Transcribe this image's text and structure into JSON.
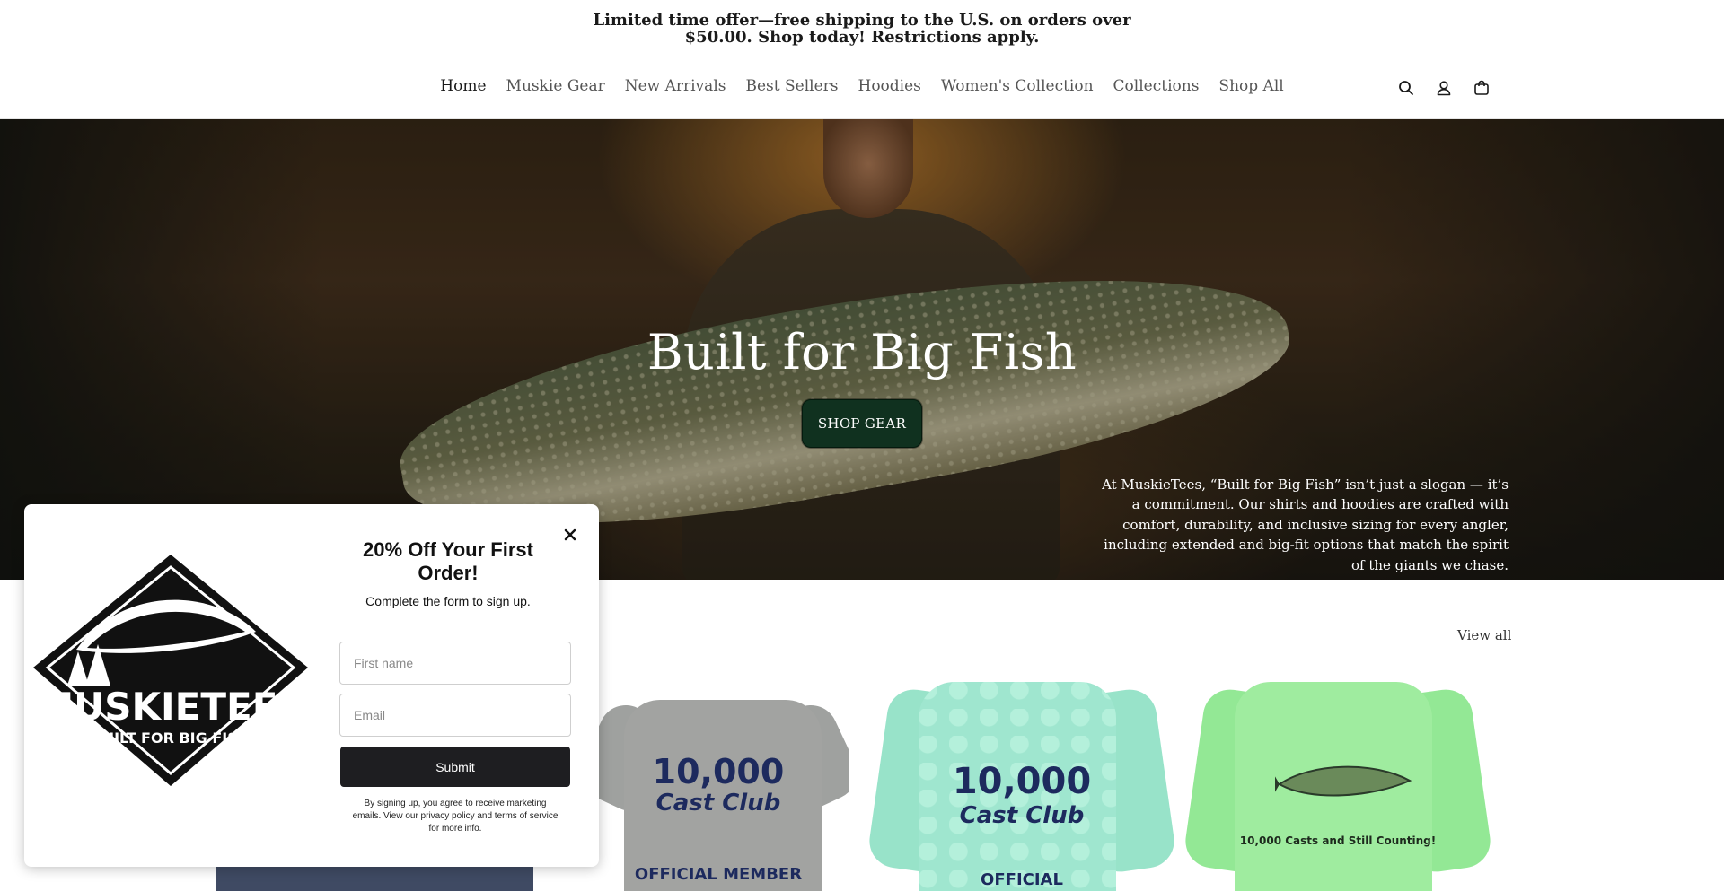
{
  "announcement": {
    "text": "Limited time offer—free shipping to the U.S. on orders over $50.00. Shop today! Restrictions apply."
  },
  "nav": {
    "items": [
      {
        "label": "Home"
      },
      {
        "label": "Muskie Gear"
      },
      {
        "label": "New Arrivals"
      },
      {
        "label": "Best Sellers"
      },
      {
        "label": "Hoodies"
      },
      {
        "label": "Women's Collection"
      },
      {
        "label": "Collections"
      },
      {
        "label": "Shop All"
      }
    ],
    "active_index": 0,
    "icons": [
      "search-icon",
      "account-icon",
      "cart-icon"
    ]
  },
  "hero": {
    "title": "Built for Big Fish",
    "button_label": "SHOP GEAR",
    "description": "At MuskieTees, “Built for Big Fish” isn’t just a slogan — it’s a commitment. Our shirts and hoodies are crafted with comfort, durability, and inclusive sizing for every angler, including extended and big-fit options that match the spirit of the giants we chase."
  },
  "products": {
    "view_all_label": "View all",
    "items": [
      {
        "print_line1": "10,000",
        "print_line2": "Cast Club",
        "print_line3": "OFFICIAL MEMBER",
        "color": "#9fa19f"
      },
      {
        "print_line1": "10,000",
        "print_line2": "Cast Club",
        "print_line3": "OFFICIAL",
        "color": "#9fe6cf"
      },
      {
        "print_caption": "10,000 Casts and Still Counting!",
        "color": "#9fec9f"
      }
    ]
  },
  "popup": {
    "logo_brand": "MUSKIETEES",
    "logo_tagline": "BUILT FOR BIG FISH",
    "title": "20% Off Your First Order!",
    "subtitle": "Complete the form to sign up.",
    "first_name_placeholder": "First name",
    "email_placeholder": "Email",
    "submit_label": "Submit",
    "legal": "By signing up, you agree to receive marketing emails. View our privacy policy and terms of service for more info."
  }
}
